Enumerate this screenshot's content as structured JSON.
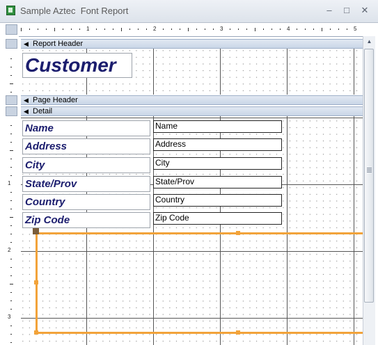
{
  "window": {
    "title": "Sample Aztec  Font Report",
    "minimize_glyph": "–",
    "maximize_glyph": "□",
    "close_glyph": "✕"
  },
  "ruler": {
    "horizontal_numbers": [
      "1",
      "2",
      "3",
      "4",
      "5"
    ],
    "vertical_numbers": [
      "1",
      "2",
      "3"
    ]
  },
  "sections": {
    "report_header": "Report Header",
    "page_header": "Page Header",
    "detail": "Detail"
  },
  "report_header": {
    "title_label": "Customer"
  },
  "detail": {
    "labels": [
      "Name",
      "Address",
      "City",
      "State/Prov",
      "Country",
      "Zip Code"
    ],
    "fields": [
      "Name",
      "Address",
      "City",
      "State/Prov",
      "Country",
      "Zip Code"
    ]
  },
  "colors": {
    "label_text": "#1b1d6e",
    "selection_outline": "#f2a33a",
    "section_band": "#c9d6e7"
  },
  "icons": {
    "app": "report-icon",
    "section_toggle": "section-arrow-icon"
  }
}
